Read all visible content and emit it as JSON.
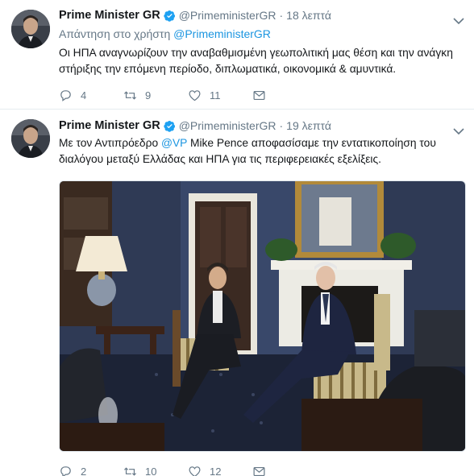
{
  "tweets": [
    {
      "name": "Prime Minister GR",
      "handle": "@PrimeministerGR",
      "time": "18 λεπτά",
      "reply_prefix": "Απάντηση στο χρήστη",
      "reply_handle": "@PrimeministerGR",
      "text": "Οι ΗΠΑ αναγνωρίζουν την αναβαθμισμένη γεωπολιτική μας θέση και την ανάγκη στήριξης την επόμενη περίοδο, διπλωματικά, οικονομικά & αμυντικά.",
      "replies": "4",
      "retweets": "9",
      "likes": "11"
    },
    {
      "name": "Prime Minister GR",
      "handle": "@PrimeministerGR",
      "time": "19 λεπτά",
      "text_before": "Με τον Αντιπρόεδρο ",
      "mention": "@VP",
      "text_after": " Mike Pence αποφασίσαμε την εντατικοποίηση του διαλόγου μεταξύ Ελλάδας και ΗΠΑ για τις περιφερειακές εξελίξεις.",
      "replies": "2",
      "retweets": "10",
      "likes": "12"
    }
  ],
  "colors": {
    "link": "#1b95e0",
    "secondary_text": "#657786",
    "verified": "#1da1f2",
    "divider": "#e6ecf0"
  },
  "icons": [
    "verified-badge-icon",
    "chevron-down-icon",
    "reply-icon",
    "retweet-icon",
    "like-heart-icon",
    "direct-message-icon"
  ]
}
